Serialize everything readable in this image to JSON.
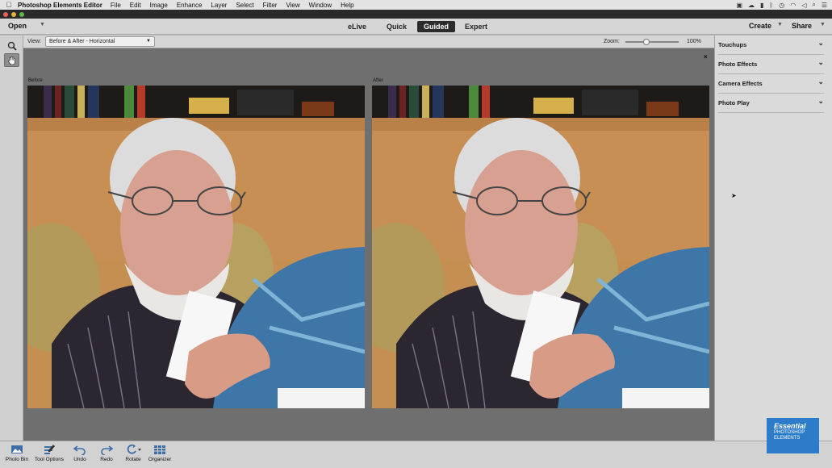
{
  "menubar": {
    "app_name": "Photoshop Elements Editor",
    "items": [
      "File",
      "Edit",
      "Image",
      "Enhance",
      "Layer",
      "Select",
      "Filter",
      "View",
      "Window",
      "Help"
    ]
  },
  "modebar": {
    "open_label": "Open",
    "modes": [
      "eLive",
      "Quick",
      "Guided",
      "Expert"
    ],
    "active_mode": "Guided",
    "create_label": "Create",
    "share_label": "Share"
  },
  "optbar": {
    "view_label": "View:",
    "view_value": "Before & After - Horizontal",
    "zoom_label": "Zoom:",
    "zoom_value": "100%",
    "zoom_fraction": 0.4
  },
  "canvas": {
    "before_label": "Before",
    "after_label": "After",
    "close_glyph": "×"
  },
  "panel": {
    "sections": [
      "Touchups",
      "Photo Effects",
      "Camera Effects",
      "Photo Play"
    ]
  },
  "bottombar": {
    "items": [
      {
        "label": "Photo Bin",
        "icon": "photo-bin-icon"
      },
      {
        "label": "Tool Options",
        "icon": "tool-options-icon"
      },
      {
        "label": "Undo",
        "icon": "undo-icon"
      },
      {
        "label": "Redo",
        "icon": "redo-icon"
      },
      {
        "label": "Rotate",
        "icon": "rotate-icon"
      },
      {
        "label": "Organizer",
        "icon": "organizer-icon"
      }
    ]
  },
  "badge": {
    "line1": "Essential",
    "line2": "PHOTOSHOP",
    "line3": "ELEMENTS"
  },
  "colors": {
    "canvas_bg": "#6f6f6f",
    "active_mode_bg": "#2b2b2b",
    "badge_bg": "#2d7cc9"
  }
}
